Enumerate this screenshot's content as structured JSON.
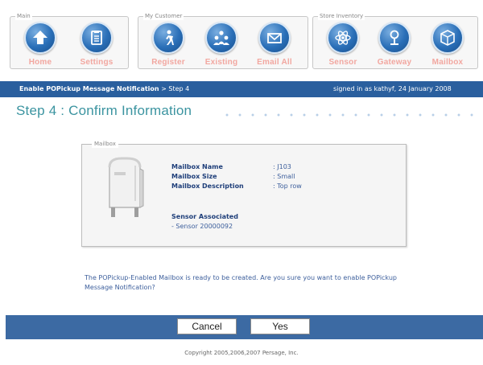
{
  "nav": {
    "groups": [
      {
        "label": "Main",
        "items": [
          {
            "label": "Home",
            "icon": "home-icon"
          },
          {
            "label": "Settings",
            "icon": "settings-icon"
          }
        ]
      },
      {
        "label": "My Customer",
        "items": [
          {
            "label": "Register",
            "icon": "register-icon"
          },
          {
            "label": "Existing",
            "icon": "existing-icon"
          },
          {
            "label": "Email All",
            "icon": "email-icon"
          }
        ]
      },
      {
        "label": "Store Inventory",
        "items": [
          {
            "label": "Sensor",
            "icon": "sensor-icon"
          },
          {
            "label": "Gateway",
            "icon": "gateway-icon"
          },
          {
            "label": "Mailbox",
            "icon": "mailbox-icon"
          }
        ]
      }
    ]
  },
  "status_bar": {
    "task": "Enable POPickup Message Notification",
    "step": " > Step 4",
    "signed_in": "signed in as kathyf, 24 January 2008"
  },
  "page": {
    "title": "Step 4 : Confirm Information"
  },
  "mailbox_panel": {
    "legend": "Mailbox",
    "fields": [
      {
        "label": "Mailbox Name",
        "value": ": J103"
      },
      {
        "label": "Mailbox Size",
        "value": ": Small"
      },
      {
        "label": "Mailbox Description",
        "value": ": Top row"
      }
    ],
    "sensor_heading": "Sensor Associated",
    "sensor_item": "- Sensor 20000092"
  },
  "confirm_message": "The POPickup-Enabled Mailbox is ready to be created. Are you sure you want to enable POPickup Message Notification?",
  "actions": {
    "cancel": "Cancel",
    "yes": "Yes"
  },
  "footer": "Copyright 2005,2006,2007 Persage, Inc.",
  "colors": {
    "nav_label": "#f2a7a0",
    "status_bar": "#2a5f9e",
    "title": "#3b94a0",
    "action_bar": "#3c6aa3"
  }
}
